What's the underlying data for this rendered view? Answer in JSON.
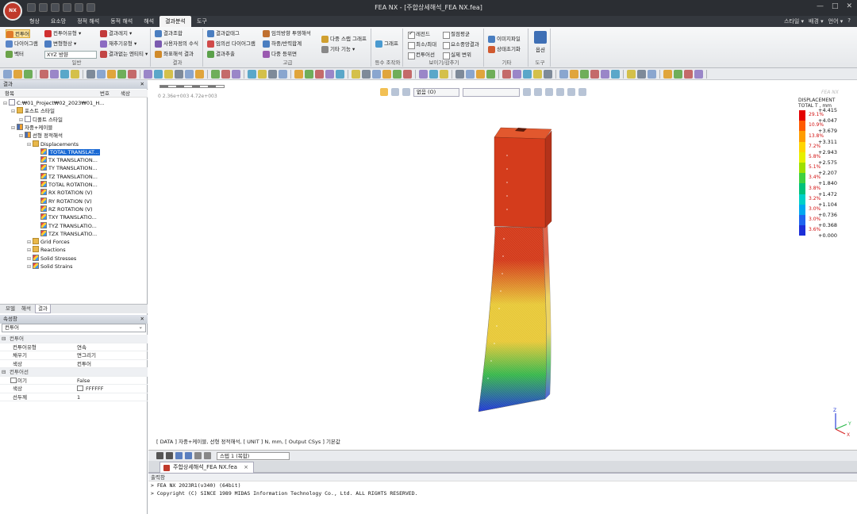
{
  "app": {
    "logo_text": "NX",
    "title": "FEA NX - [주합상세해석_FEA NX.fea]",
    "window_controls": [
      "—",
      "□",
      "✕"
    ]
  },
  "menu": {
    "tabs": [
      "형상",
      "요소망",
      "정적 해석",
      "동적 해석",
      "해석",
      "결과분석",
      "도구"
    ],
    "active_index": 5,
    "right": [
      "스타일 ▾",
      "배경 ▾",
      "언어 ▾",
      "?"
    ]
  },
  "ribbon": {
    "groups": [
      {
        "label": "일반",
        "items": [
          "컨투어",
          "다이어그램",
          "벡터",
          "컨투어유형 ▾",
          "변형형상 ▾",
          "XYZ 방향",
          "결과레지 ▾",
          "재추기유형 ▾",
          "결과없는 엔티티 ▾"
        ]
      },
      {
        "label": "결과",
        "items": [
          "결과조합",
          "사용자정의 수식",
          "좌표해석 결과"
        ]
      },
      {
        "label": "고급",
        "items": [
          "결과값태그",
          "임의선 다이어그램",
          "결과추출",
          "임의방향 투영해석",
          "하중/반력합계",
          "다중 등위면",
          "다중 스랩 그래프",
          "기타 기능 ▾"
        ]
      },
      {
        "label": "등수 조작와",
        "items": [
          "그래프"
        ]
      },
      {
        "label": "보이기/감추기",
        "items": [
          "레전드",
          "최소/최대",
          "컨투어선",
          "절점평균",
          "요소중앙결과",
          "실제 변위"
        ]
      },
      {
        "label": "기타",
        "items": [
          "이미지파일",
          "상태초기화"
        ]
      },
      {
        "label": "도구",
        "items": [
          "옵션"
        ]
      }
    ]
  },
  "tree": {
    "panel_title": "결과",
    "columns": [
      "항목",
      "번호",
      "색상"
    ],
    "nodes": [
      {
        "label": "C:₩01_Project₩02_2023₩01_H...",
        "indent": 0,
        "icon": "doc"
      },
      {
        "label": "포스트 스타일",
        "indent": 1,
        "icon": "folder"
      },
      {
        "label": "디폴트 스타일",
        "indent": 2,
        "icon": "doc"
      },
      {
        "label": "자중+케이블",
        "indent": 1,
        "icon": "grid"
      },
      {
        "label": "선형 정적해석",
        "indent": 2,
        "icon": "grid"
      },
      {
        "label": "Displacements",
        "indent": 3,
        "icon": "folder"
      },
      {
        "label": "TOTAL TRANSLAT...",
        "indent": 4,
        "icon": "contour",
        "selected": true
      },
      {
        "label": "TX TRANSLATION...",
        "indent": 4,
        "icon": "contour"
      },
      {
        "label": "TY TRANSLATION...",
        "indent": 4,
        "icon": "contour"
      },
      {
        "label": "TZ TRANSLATION...",
        "indent": 4,
        "icon": "contour"
      },
      {
        "label": "TOTAL ROTATION...",
        "indent": 4,
        "icon": "contour"
      },
      {
        "label": "RX ROTATION (V)",
        "indent": 4,
        "icon": "contour"
      },
      {
        "label": "RY ROTATION (V)",
        "indent": 4,
        "icon": "contour"
      },
      {
        "label": "RZ ROTATION (V)",
        "indent": 4,
        "icon": "contour"
      },
      {
        "label": "TXY TRANSLATIO...",
        "indent": 4,
        "icon": "contour"
      },
      {
        "label": "TYZ TRANSLATIO...",
        "indent": 4,
        "icon": "contour"
      },
      {
        "label": "TZX TRANSLATIO...",
        "indent": 4,
        "icon": "contour"
      },
      {
        "label": "Grid Forces",
        "indent": 3,
        "icon": "folder"
      },
      {
        "label": "Reactions",
        "indent": 3,
        "icon": "folder"
      },
      {
        "label": "Solid Stresses",
        "indent": 3,
        "icon": "contour"
      },
      {
        "label": "Solid Strains",
        "indent": 3,
        "icon": "contour"
      }
    ]
  },
  "panel_tabs": [
    "모델",
    "해석",
    "결과"
  ],
  "panel_tabs_active": 2,
  "properties": {
    "title": "속성창",
    "selected": "컨투어",
    "rows": [
      {
        "type": "section",
        "label": "컨투어"
      },
      {
        "key": "컨투어유형",
        "value": "연속"
      },
      {
        "key": "채우기",
        "value": "면그리기"
      },
      {
        "key": "색상",
        "value": "컨투어"
      },
      {
        "type": "section",
        "label": "컨투어선"
      },
      {
        "key": "보이기",
        "value": "False",
        "checkbox": true
      },
      {
        "key": "색상",
        "value": "FFFFFF",
        "swatch": true
      },
      {
        "key": "선두께",
        "value": "1"
      }
    ]
  },
  "view": {
    "toolbar_dropdown": "없음 (O)",
    "scale_label": "0       2.36e+003  4.72e+003",
    "info": "[ DATA ] 자중+케이블, 선형 정적해석,  [ UNIT ]  N, mm,  [ Output CSys ]  기본값",
    "legend": {
      "logo": "FEA NX",
      "title_lines": [
        "DISPLACEMENT",
        "TOTAL T , mm"
      ],
      "ticks": [
        "+4.415",
        "+4.047",
        "+3.679",
        "+3.311",
        "+2.943",
        "+2.575",
        "+2.207",
        "+1.840",
        "+1.472",
        "+1.104",
        "+0.736",
        "+0.368",
        "+0.000"
      ],
      "percents": [
        "29.1%",
        "10.9%",
        "13.8%",
        "7.2%",
        "5.8%",
        "5.1%",
        "3.4%",
        "3.8%",
        "3.2%",
        "3.0%",
        "3.0%",
        "3.6%"
      ],
      "colors": [
        "#e30000",
        "#ff5a00",
        "#ff9c00",
        "#ffd500",
        "#e6f000",
        "#9ee000",
        "#3fd13f",
        "#00c27a",
        "#00d0c8",
        "#00a8f0",
        "#1e64f0",
        "#1c2fd8"
      ]
    },
    "triad": {
      "x": "X",
      "y": "Y",
      "z": "Z"
    },
    "contour_colors": {
      "top": "#d43c1c",
      "mid": "#e8c93a",
      "low": "#3ab84e",
      "base": "#2339d6"
    }
  },
  "playback": {
    "step": "스텝 1 (복합)"
  },
  "document_tab": {
    "label": "주합상세해석_FEA NX.fea",
    "close": "×"
  },
  "output": {
    "title": "출력창",
    "lines": [
      "> FEA NX 2023R1(v340) (64bit)",
      "> Copyright (C) SINCE 1989 MIDAS Information Technology Co., Ltd. ALL RIGHTS RESERVED."
    ]
  }
}
